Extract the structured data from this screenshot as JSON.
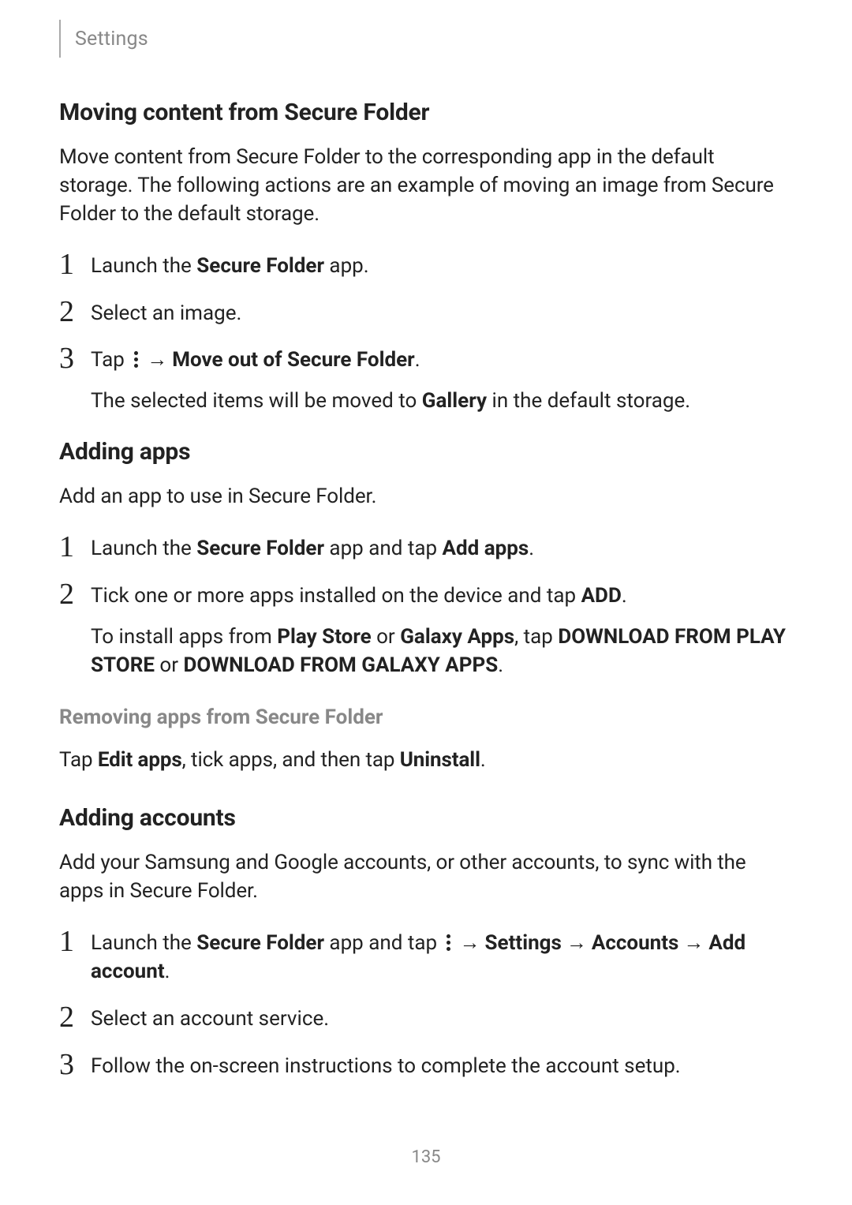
{
  "header": {
    "breadcrumb": "Settings"
  },
  "pageNumber": "135",
  "glyphs": {
    "arrow": "→"
  },
  "sections": {
    "moving": {
      "title": "Moving content from Secure Folder",
      "intro": "Move content from Secure Folder to the corresponding app in the default storage. The following actions are an example of moving an image from Secure Folder to the default storage.",
      "steps": {
        "s1": {
          "num": "1",
          "prefix": "Launch the ",
          "bold": "Secure Folder",
          "suffix": " app."
        },
        "s2": {
          "num": "2",
          "text": "Select an image."
        },
        "s3": {
          "num": "3",
          "line1_prefix": "Tap ",
          "line1_arrow": "→",
          "line1_bold": "Move out of Secure Folder",
          "line1_suffix": ".",
          "line2_prefix": "The selected items will be moved to ",
          "line2_bold": "Gallery",
          "line2_suffix": " in the default storage."
        }
      }
    },
    "addingApps": {
      "title": "Adding apps",
      "intro": "Add an app to use in Secure Folder.",
      "steps": {
        "s1": {
          "num": "1",
          "prefix": "Launch the ",
          "bold1": "Secure Folder",
          "mid": " app and tap ",
          "bold2": "Add apps",
          "suffix": "."
        },
        "s2": {
          "num": "2",
          "line1_prefix": "Tick one or more apps installed on the device and tap ",
          "line1_bold": "ADD",
          "line1_suffix": ".",
          "line2_p1": "To install apps from ",
          "line2_b1": "Play Store",
          "line2_p2": " or ",
          "line2_b2": "Galaxy Apps",
          "line2_p3": ", tap ",
          "line2_b3": "DOWNLOAD FROM PLAY STORE",
          "line2_p4": " or ",
          "line2_b4": "DOWNLOAD FROM GALAXY APPS",
          "line2_p5": "."
        }
      },
      "removing": {
        "subtitle": "Removing apps from Secure Folder",
        "p1": "Tap ",
        "b1": "Edit apps",
        "p2": ", tick apps, and then tap ",
        "b2": "Uninstall",
        "p3": "."
      }
    },
    "addingAccounts": {
      "title": "Adding accounts",
      "intro": "Add your Samsung and Google accounts, or other accounts, to sync with the apps in Secure Folder.",
      "steps": {
        "s1": {
          "num": "1",
          "prefix": "Launch the ",
          "bold1": "Secure Folder",
          "mid": " app and tap ",
          "arrow": "→",
          "bold2": "Settings",
          "bold3": "Accounts",
          "bold4": "Add account",
          "suffix": "."
        },
        "s2": {
          "num": "2",
          "text": "Select an account service."
        },
        "s3": {
          "num": "3",
          "text": "Follow the on-screen instructions to complete the account setup."
        }
      }
    }
  }
}
